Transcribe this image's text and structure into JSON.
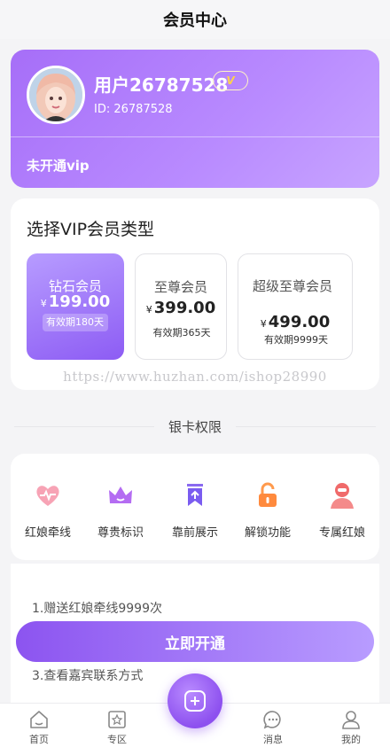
{
  "header": {
    "title": "会员中心"
  },
  "profile": {
    "username": "用户26787528",
    "vip_badge": "V",
    "id_text": "ID: 26787528",
    "status": "未开通vip"
  },
  "plans": {
    "title": "选择VIP会员类型",
    "items": [
      {
        "name": "钻石会员",
        "currency": "¥",
        "price": "199.00",
        "validity": "有效期180天",
        "selected": true
      },
      {
        "name": "至尊会员",
        "currency": "¥",
        "price": "399.00",
        "validity": "有效期365天",
        "selected": false
      },
      {
        "name": "超级至尊会员",
        "currency": "¥",
        "price": "499.00",
        "validity": "有效期9999天",
        "selected": false
      }
    ],
    "watermark": "https://www.huzhan.com/ishop28990"
  },
  "privileges": {
    "title": "银卡权限",
    "items": [
      {
        "label": "红娘牵线",
        "icon": "heart-pulse-icon",
        "color": "#f36b8a"
      },
      {
        "label": "尊贵标识",
        "icon": "crown-icon",
        "color": "#a95cf0"
      },
      {
        "label": "靠前展示",
        "icon": "bookmark-top-icon",
        "color": "#7a5cf0"
      },
      {
        "label": "解锁功能",
        "icon": "unlock-icon",
        "color": "#ff8a3d"
      },
      {
        "label": "专属红娘",
        "icon": "matchmaker-icon",
        "color": "#f06a6a"
      }
    ]
  },
  "benefits": {
    "items": [
      "1.赠送红娘牵线9999次",
      "3.查看嘉宾联系方式"
    ]
  },
  "cta": {
    "label": "立即开通"
  },
  "tabbar": {
    "items": [
      {
        "label": "首页",
        "icon": "home-icon"
      },
      {
        "label": "专区",
        "icon": "star-box-icon"
      },
      {
        "label": "消息",
        "icon": "message-icon"
      },
      {
        "label": "我的",
        "icon": "user-icon"
      }
    ],
    "center_icon": "plus-icon"
  },
  "colors": {
    "accent": "#9b63f5",
    "accent_light": "#c7a4ff",
    "background": "#f4f4f6"
  }
}
